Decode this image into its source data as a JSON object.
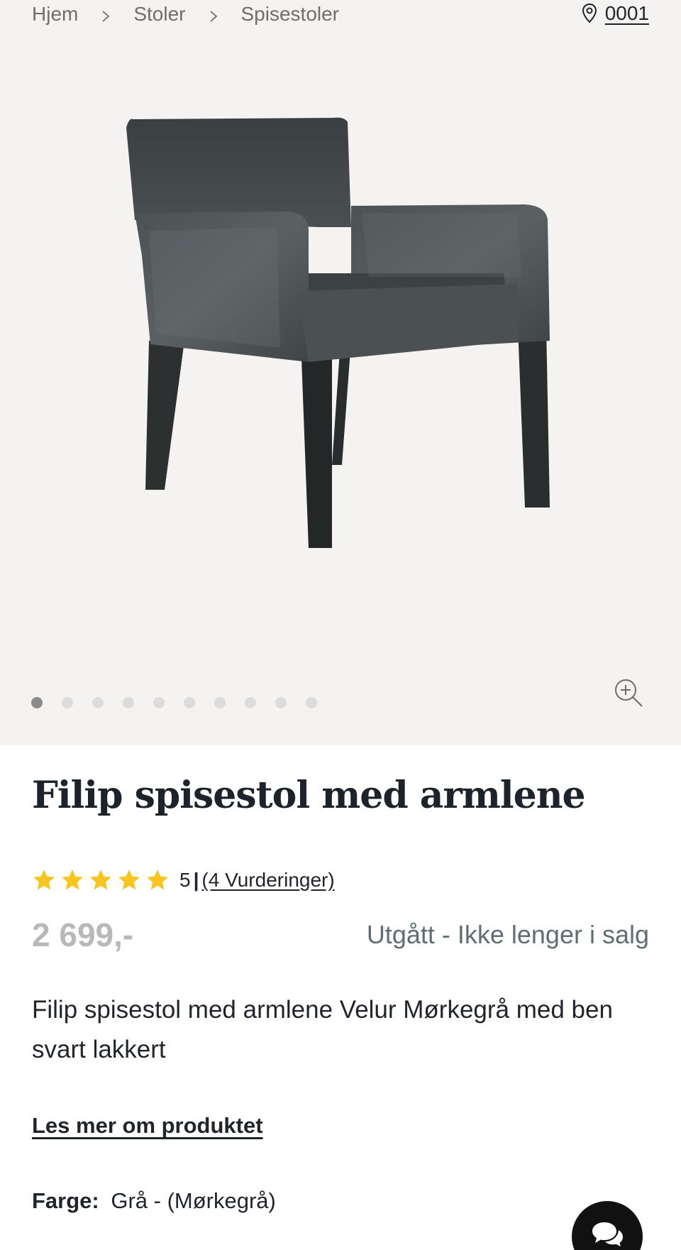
{
  "breadcrumb": {
    "items": [
      "Hjem",
      "Stoler",
      "Spisestoler"
    ]
  },
  "store": {
    "code": "0001",
    "icon": "map-pin-icon"
  },
  "gallery": {
    "image_alt": "Filip spisestol med armlene",
    "dot_count": 10,
    "active_index": 0,
    "zoom_icon": "zoom-in-icon"
  },
  "product": {
    "title": "Filip spisestol med armlene",
    "rating_value": "5",
    "rating_stars": 5,
    "reviews_label": "(4 Vurderinger)",
    "price": "2 699,-",
    "availability": "Utgått - Ikke lenger i salg",
    "description": "Filip spisestol med armlene Velur Mørkegrå med ben svart lakkert",
    "read_more": "Les mer om produktet",
    "color_label": "Farge:",
    "color_value": "Grå - (Mørkegrå)"
  },
  "chat": {
    "icon": "chat-icon"
  },
  "colors": {
    "hero_bg": "#f5f3f1",
    "star": "#f7c51c",
    "price_muted": "#b8b8b8",
    "availability": "#5f6e73",
    "text": "#1f252b",
    "chat_bg": "#111111"
  }
}
